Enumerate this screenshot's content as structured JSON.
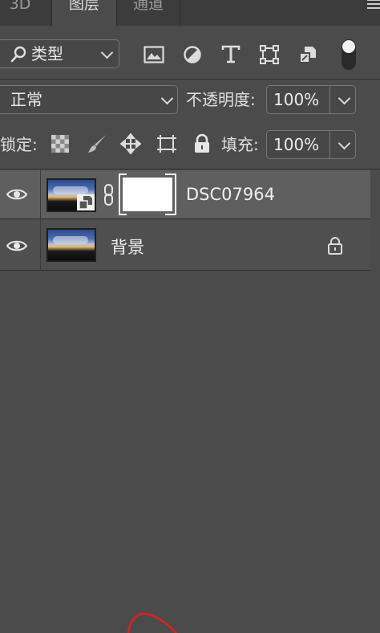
{
  "tabs": [
    {
      "label": "3D"
    },
    {
      "label": "图层"
    },
    {
      "label": "通道"
    }
  ],
  "filter": {
    "kind_label": "类型"
  },
  "filter_icons": [
    "image-filter-icon",
    "adjustment-filter-icon",
    "text-filter-icon",
    "shape-filter-icon",
    "smart-object-filter-icon",
    "filter-toggle-switch"
  ],
  "blend": {
    "mode": "正常",
    "opacity_label": "不透明度:",
    "opacity_value": "100%"
  },
  "lock": {
    "label": "锁定:",
    "fill_label": "填充:",
    "fill_value": "100%"
  },
  "layers": [
    {
      "name": "DSC07964",
      "selected": true,
      "has_mask": true,
      "smart_object": true,
      "locked": false
    },
    {
      "name": "背景",
      "selected": false,
      "has_mask": false,
      "smart_object": false,
      "locked": true
    }
  ],
  "colors": {
    "panel_bg": "#4b4b4b",
    "selected_row": "#5f5f5f",
    "annotation": "#e0201c"
  }
}
